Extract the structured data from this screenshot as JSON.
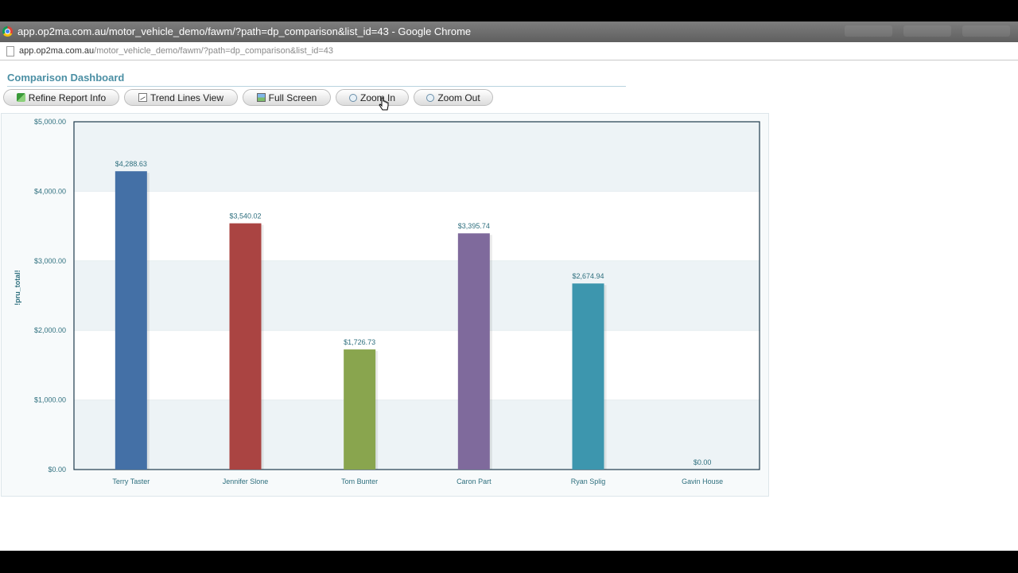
{
  "window": {
    "title": "app.op2ma.com.au/motor_vehicle_demo/fawm/?path=dp_comparison&list_id=43 - Google Chrome"
  },
  "address": {
    "host": "app.op2ma.com.au",
    "path": "/motor_vehicle_demo/fawm/?path=dp_comparison&list_id=43"
  },
  "page": {
    "title": "Comparison Dashboard"
  },
  "toolbar": {
    "refine_label": "Refine Report Info",
    "trend_label": "Trend Lines View",
    "fullscreen_label": "Full Screen",
    "zoom_in_label": "Zoom In",
    "zoom_out_label": "Zoom Out"
  },
  "chart_data": {
    "type": "bar",
    "ylabel": "!pru_total!",
    "ylim": [
      0,
      5000
    ],
    "y_ticks": [
      0,
      1000,
      2000,
      3000,
      4000,
      5000
    ],
    "y_tick_labels": [
      "$0.00",
      "$1,000.00",
      "$2,000.00",
      "$3,000.00",
      "$4,000.00",
      "$5,000.00"
    ],
    "categories": [
      "Terry Taster",
      "Jennifer Slone",
      "Tom Bunter",
      "Caron Part",
      "Ryan Splig",
      "Gavin House"
    ],
    "values": [
      4288.63,
      3540.02,
      1726.73,
      3395.74,
      2674.94,
      0.0
    ],
    "value_labels": [
      "$4,288.63",
      "$3,540.02",
      "$1,726.73",
      "$3,395.74",
      "$2,674.94",
      "$0.00"
    ],
    "colors": [
      "#4470a6",
      "#aa4442",
      "#89a54e",
      "#7f6a9c",
      "#3d96ae",
      "#c08040"
    ],
    "grid": true,
    "band_color": "#edf3f6"
  }
}
